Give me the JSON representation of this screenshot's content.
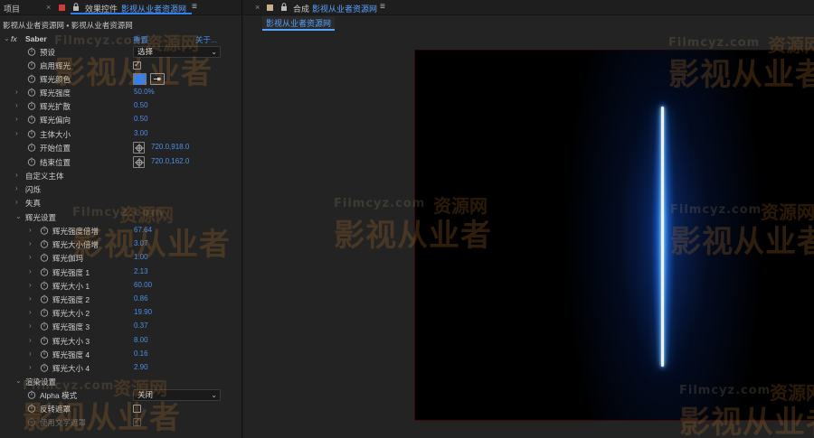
{
  "left_panel": {
    "tab_project": "项目",
    "tab_effects_controls": "效果控件",
    "tab_effects_comp": "影视从业者资源网",
    "breadcrumb": "影视从业者资源网 • 影视从业者资源网",
    "effect_name": "Saber",
    "effect_reset": "重置",
    "effect_about": "关于...",
    "properties": [
      {
        "label": "预设",
        "kind": "dropdown",
        "value": "选择"
      },
      {
        "label": "启用辉光",
        "kind": "checkbox",
        "checked": true
      },
      {
        "label": "辉光颜色",
        "kind": "color",
        "color": "#2a80ff"
      },
      {
        "label": "辉光强度",
        "kind": "value",
        "value": "50.0%"
      },
      {
        "label": "辉光扩散",
        "kind": "value",
        "value": "0.50"
      },
      {
        "label": "辉光偏向",
        "kind": "value",
        "value": "0.50"
      },
      {
        "label": "主体大小",
        "kind": "value",
        "value": "3.00"
      },
      {
        "label": "开始位置",
        "kind": "point",
        "value": "720.0,918.0"
      },
      {
        "label": "结束位置",
        "kind": "point",
        "value": "720.0,162.0"
      }
    ],
    "groups": [
      "自定义主体",
      "闪烁",
      "失真"
    ],
    "glow_settings": {
      "title": "辉光设置",
      "items": [
        {
          "label": "辉光强度倍增",
          "value": "67.64"
        },
        {
          "label": "辉光大小倍增",
          "value": "3.07"
        },
        {
          "label": "辉光伽玛",
          "value": "1.00"
        },
        {
          "label": "辉光强度 1",
          "value": "2.13"
        },
        {
          "label": "辉光大小 1",
          "value": "60.00"
        },
        {
          "label": "辉光强度 2",
          "value": "0.86"
        },
        {
          "label": "辉光大小 2",
          "value": "19.90"
        },
        {
          "label": "辉光强度 3",
          "value": "0.37"
        },
        {
          "label": "辉光大小 3",
          "value": "8.00"
        },
        {
          "label": "辉光强度 4",
          "value": "0.16"
        },
        {
          "label": "辉光大小 4",
          "value": "2.90"
        }
      ]
    },
    "render_settings": {
      "title": "渲染设置",
      "alpha_label": "Alpha 模式",
      "alpha_value": "关闭",
      "invert_label": "反转遮罩",
      "use_text_label": "使用文字遮罩"
    }
  },
  "right_panel": {
    "tab_comp": "合成",
    "tab_comp_name": "影视从业者资源网",
    "subtab": "影视从业者资源网"
  },
  "watermark": {
    "latin": "Filmcyz.com",
    "cn_small": "资源网",
    "cn_large": "影视从业者"
  },
  "colors": {
    "accent": "#2f7ff0",
    "value_blue": "#4a8fe8",
    "glow": "#2a80ff"
  }
}
